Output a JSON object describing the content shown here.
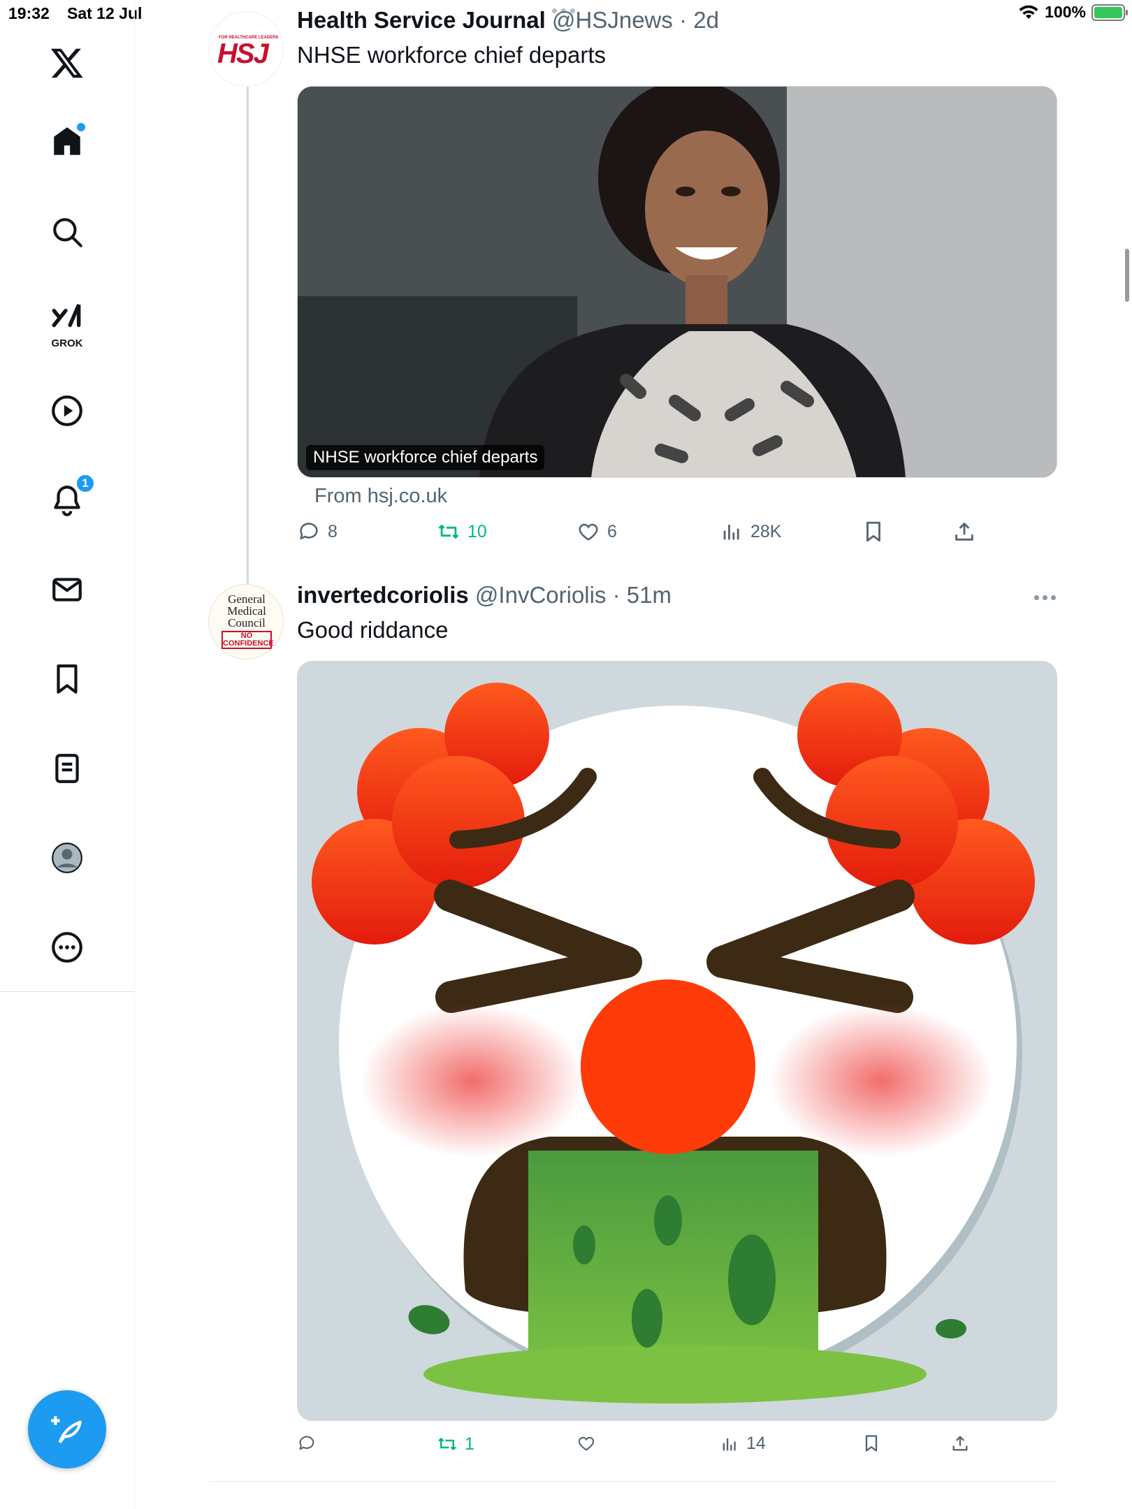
{
  "status_bar": {
    "time": "19:32",
    "date": "Sat 12 Jul",
    "battery": "100%"
  },
  "sidebar": {
    "logo": "x-logo-icon",
    "items": [
      {
        "name": "home",
        "icon": "home-icon"
      },
      {
        "name": "explore",
        "icon": "search-icon"
      },
      {
        "name": "grok",
        "icon": "grok-icon",
        "label": "GROK"
      },
      {
        "name": "video",
        "icon": "play-icon"
      },
      {
        "name": "notifications",
        "icon": "bell-icon",
        "badge": "1"
      },
      {
        "name": "messages",
        "icon": "mail-icon"
      },
      {
        "name": "bookmarks",
        "icon": "bookmark-icon"
      },
      {
        "name": "lists",
        "icon": "list-icon"
      },
      {
        "name": "profile",
        "icon": "profile-icon"
      },
      {
        "name": "more",
        "icon": "more-circle-icon"
      }
    ],
    "compose": "compose-icon"
  },
  "tweets": [
    {
      "avatar_text": "HSJ",
      "avatar_subtext": "FOR HEALTHCARE LEADERS",
      "name": "Health Service Journal",
      "handle": "@HSJnews",
      "time": "· 2d",
      "text": "NHSE workforce chief departs",
      "card_caption": "NHSE workforce chief departs",
      "card_source": "From hsj.co.uk",
      "replies": "8",
      "reposts": "10",
      "likes": "6",
      "views": "28K"
    },
    {
      "avatar_lines": [
        "General",
        "Medical",
        "Council"
      ],
      "avatar_stamp": [
        "NO",
        "CONFIDENCE"
      ],
      "name": "invertedcoriolis",
      "handle": "@InvCoriolis",
      "time": "· 51m",
      "text": "Good riddance",
      "replies": "",
      "reposts": "1",
      "likes": "",
      "views": "14"
    }
  ],
  "colors": {
    "accent": "#1d9bf0",
    "repost": "#00ba7c",
    "secondary_text": "#536471"
  }
}
